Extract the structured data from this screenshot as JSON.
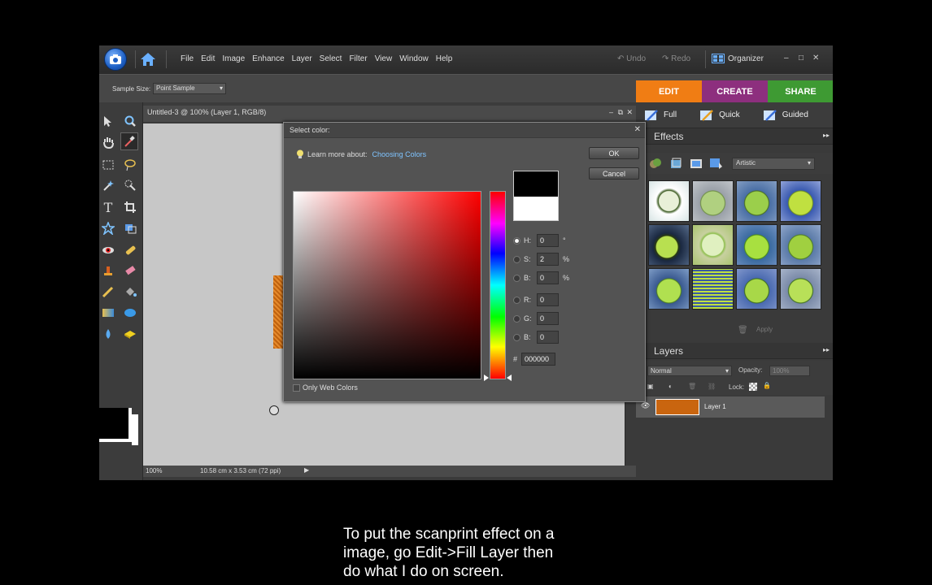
{
  "menubar": {
    "items": [
      "File",
      "Edit",
      "Image",
      "Enhance",
      "Layer",
      "Select",
      "Filter",
      "View",
      "Window",
      "Help"
    ],
    "undo": "Undo",
    "redo": "Redo",
    "organizer": "Organizer"
  },
  "options": {
    "sample_size_label": "Sample Size:",
    "sample_size_value": "Point Sample"
  },
  "mode_tabs": [
    {
      "label": "EDIT",
      "color": "#f07d14"
    },
    {
      "label": "CREATE",
      "color": "#8d2f7e"
    },
    {
      "label": "SHARE",
      "color": "#3e9a33"
    }
  ],
  "edit_modes": [
    "Full",
    "Quick",
    "Guided"
  ],
  "document": {
    "title": "Untitled-3 @ 100% (Layer 1, RGB/8)",
    "zoom": "100%",
    "doc_size": "10.58 cm x 3.53 cm (72 ppi)"
  },
  "effects_panel": {
    "title": "Effects",
    "category": "Artistic",
    "apply_label": "Apply"
  },
  "layers_panel": {
    "title": "Layers",
    "blend_mode": "Normal",
    "opacity_label": "Opacity:",
    "opacity_value": "100%",
    "lock_label": "Lock:",
    "layer_name": "Layer 1",
    "layer_color": "#c9650f"
  },
  "dialog": {
    "title": "Select color:",
    "learn_more": "Learn more about:",
    "learn_link": "Choosing Colors",
    "ok": "OK",
    "cancel": "Cancel",
    "fields": [
      {
        "label": "H:",
        "value": "0",
        "unit": "°",
        "selected": true
      },
      {
        "label": "S:",
        "value": "2",
        "unit": "%",
        "selected": false
      },
      {
        "label": "B:",
        "value": "0",
        "unit": "%",
        "selected": false
      },
      {
        "label": "R:",
        "value": "0",
        "unit": "",
        "selected": false
      },
      {
        "label": "G:",
        "value": "0",
        "unit": "",
        "selected": false
      },
      {
        "label": "B:",
        "value": "0",
        "unit": "",
        "selected": false
      }
    ],
    "hex_label": "#",
    "hex_value": "000000",
    "only_web_colors": "Only Web Colors",
    "new_color": "#000000",
    "current_color": "#ffffff"
  },
  "caption": [
    "To put the scanprint effect on a",
    "image, go Edit->Fill Layer then",
    "do what I do on screen."
  ]
}
